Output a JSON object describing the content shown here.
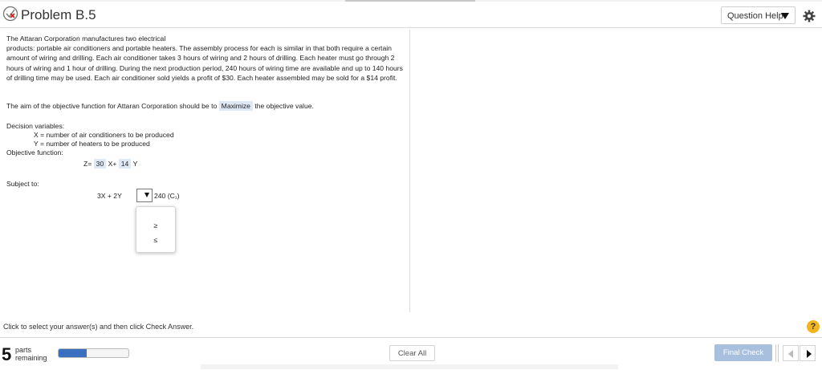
{
  "header": {
    "title": "Problem B.5",
    "question_help_label": "Question Help"
  },
  "problem": {
    "text": "The Attaran Corporation manufactures two electrical\nproducts: portable air conditioners and portable heaters.  The assembly process for each is similar in that both require a certain amount of wiring and drilling.  Each air conditioner takes 3 hours of wiring and 2 hours of drilling. Each heater must go through 2 hours of wiring and 1 hour of drilling. During the next production period, 240 hours of wiring time are available and up to 140 hours of drilling time may be used. Each air conditioner sold yields a profit of $30.  Each heater assembled may be sold for a $14 profit.",
    "aim_prefix": "The aim of the objective function for Attaran Corporation should be to",
    "aim_answer": "Maximize",
    "aim_suffix": "the objective value.",
    "decision_variables_label": "Decision variables:",
    "x_def": "X = number of air conditioners to be produced",
    "y_def": "Y = number of heaters to be produced",
    "objective_label": "Objective function:",
    "z_label": "Z=",
    "x_coef": "30",
    "x_var": "X+",
    "y_coef": "14",
    "y_var": "Y",
    "subject_to_label": "Subject to:",
    "constraint_lhs": "3X + 2Y",
    "constraint_rhs": "240",
    "constraint_name": "(C₁)",
    "dropdown_options": [
      "",
      "≥",
      "≤"
    ]
  },
  "instruction": "Click to select your answer(s) and then click Check Answer.",
  "help_symbol": "?",
  "footer": {
    "parts_count": "5",
    "parts_line1": "parts",
    "parts_line2": "remaining",
    "progress_fraction": 0.4,
    "clear_all_label": "Clear All",
    "final_check_label": "Final Check"
  },
  "colors": {
    "progress": "#3b6fbf",
    "final_check": "#a8c0dd",
    "help_icon": "#f2b51f",
    "answer_chip": "#dfe8f5"
  }
}
